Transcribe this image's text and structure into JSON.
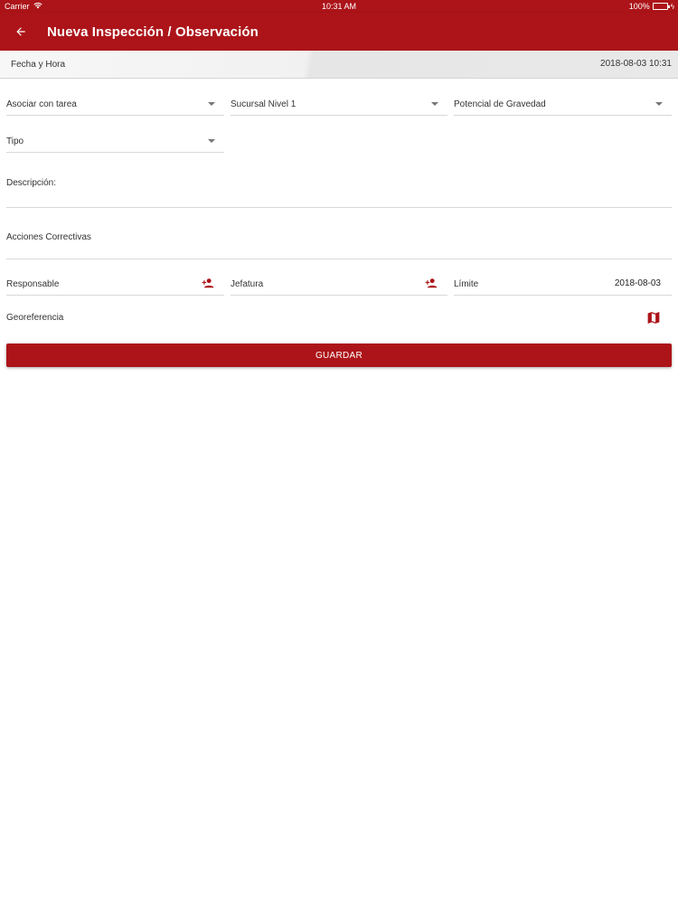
{
  "status_bar": {
    "carrier": "Carrier",
    "time": "10:31 AM",
    "battery": "100%",
    "icons": [
      "wifi-icon",
      "battery-icon",
      "charging-icon"
    ]
  },
  "app_bar": {
    "title": "Nueva Inspección / Observación",
    "back_icon": "arrow-back-icon",
    "background_color": "#ac1419"
  },
  "datetime": {
    "label": "Fecha y Hora",
    "value": "2018-08-03 10:31"
  },
  "form": {
    "asociar_label": "Asociar con tarea",
    "sucursal_label": "Sucursal Nivel 1",
    "potencial_label": "Potencial de Gravedad",
    "tipo_label": "Tipo",
    "descripcion_label": "Descripción:",
    "acciones_label": "Acciones Correctivas",
    "responsable_label": "Responsable",
    "jefatura_label": "Jefatura",
    "limite_label": "Límite",
    "limite_value": "2018-08-03",
    "georeferencia_label": "Georeferencia"
  },
  "actions": {
    "save_label": "GUARDAR"
  }
}
